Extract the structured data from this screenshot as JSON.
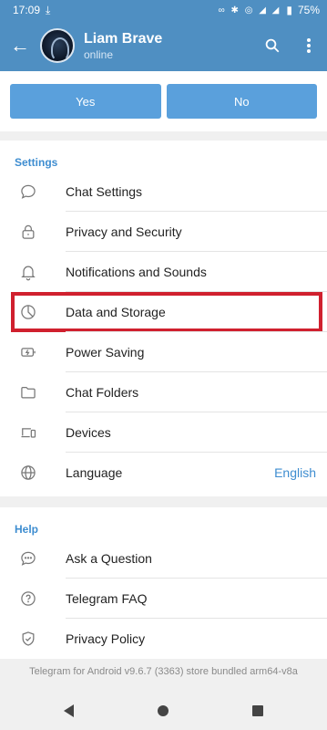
{
  "status_bar": {
    "time": "17:09",
    "left_icon": "download-check-icon",
    "right_icons": "∞ ✱ ◎ ◢ ◢",
    "battery": "75%"
  },
  "header": {
    "name": "Liam Brave",
    "status": "online"
  },
  "buttons": {
    "yes": "Yes",
    "no": "No"
  },
  "settings": {
    "title": "Settings",
    "items": [
      {
        "label": "Chat Settings",
        "icon": "chat-bubble-icon"
      },
      {
        "label": "Privacy and Security",
        "icon": "lock-icon"
      },
      {
        "label": "Notifications and Sounds",
        "icon": "bell-icon"
      },
      {
        "label": "Data and Storage",
        "icon": "pie-chart-icon"
      },
      {
        "label": "Power Saving",
        "icon": "battery-icon"
      },
      {
        "label": "Chat Folders",
        "icon": "folder-icon"
      },
      {
        "label": "Devices",
        "icon": "devices-icon"
      },
      {
        "label": "Language",
        "icon": "globe-icon",
        "value": "English"
      }
    ]
  },
  "help": {
    "title": "Help",
    "items": [
      {
        "label": "Ask a Question",
        "icon": "chat-dots-icon"
      },
      {
        "label": "Telegram FAQ",
        "icon": "question-icon"
      },
      {
        "label": "Privacy Policy",
        "icon": "shield-check-icon"
      }
    ]
  },
  "footer": "Telegram for Android v9.6.7 (3363) store bundled arm64-v8a",
  "colors": {
    "header": "#4f8fc2",
    "accent": "#3e8dd0",
    "button": "#5aa0dc",
    "highlight": "#d0202e"
  }
}
